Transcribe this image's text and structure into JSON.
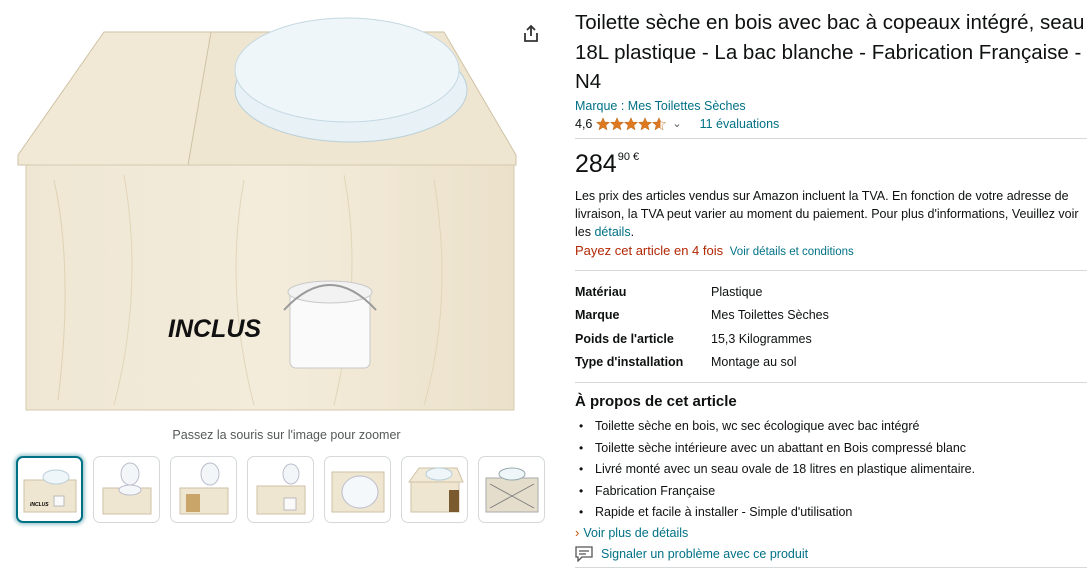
{
  "product": {
    "title": "Toilette sèche en bois avec bac à copeaux intégré, seau 18L plastique - La bac blanche - Fabrication Française - N4",
    "brand_link": "Marque : Mes Toilettes Sèches",
    "rating_value": "4,6",
    "rating_stars": 4.6,
    "reviews_link": "11 évaluations",
    "price_whole": "284",
    "price_fraction": "90 €",
    "vat_text": "Les prix des articles vendus sur Amazon incluent la TVA. En fonction de votre adresse de livraison, la TVA peut varier au moment du paiement. Pour plus d'informations, Veuillez voir les ",
    "vat_link": "détails",
    "vat_end": ".",
    "pay_text": "Payez cet article en 4 fois",
    "pay_link": "Voir détails et conditions"
  },
  "gallery": {
    "main_image_label": "INCLUS",
    "zoom_hint": "Passez la souris sur l'image pour zoomer",
    "thumb_count": 7,
    "selected_index": 0,
    "thumb_label": "INCLUS"
  },
  "specs": [
    {
      "key": "Matériau",
      "value": "Plastique"
    },
    {
      "key": "Marque",
      "value": "Mes Toilettes Sèches"
    },
    {
      "key": "Poids de l'article",
      "value": "15,3 Kilogrammes"
    },
    {
      "key": "Type d'installation",
      "value": "Montage au sol"
    }
  ],
  "about": {
    "title": "À propos de cet article",
    "bullets": [
      "Toilette sèche en bois, wc sec écologique avec bac intégré",
      "Toilette sèche intérieure avec un abattant en Bois compressé blanc",
      "Livré monté avec un seau ovale de 18 litres en plastique alimentaire.",
      "Fabrication Française",
      "Rapide et facile à installer - Simple d'utilisation"
    ],
    "more_link": "Voir plus de détails"
  },
  "report_link": "Signaler un problème avec ce produit",
  "colors": {
    "link": "#007185",
    "price_red": "#b12704",
    "star": "#de7921",
    "wood": "#efe6d2"
  },
  "icons": [
    "share-icon",
    "star-icon",
    "chevron-down-icon",
    "report-icon"
  ]
}
